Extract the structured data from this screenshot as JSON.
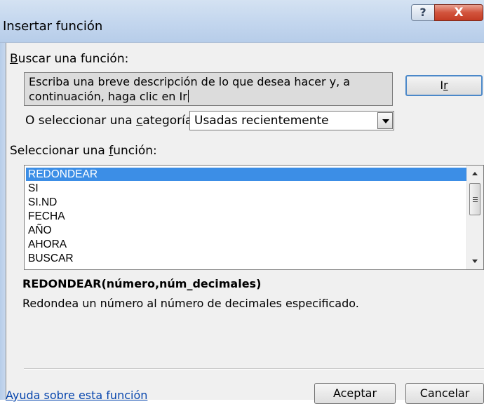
{
  "window": {
    "title": "Insertar función",
    "help_glyph": "?",
    "close_glyph": "X"
  },
  "search": {
    "label_first": "B",
    "label_rest": "uscar una función:",
    "value": "Escriba una breve descripción de lo que desea hacer y, a\ncontinuación, haga clic en Ir",
    "go_button_pre": "I",
    "go_button_under": "r"
  },
  "category": {
    "label_pre": "O seleccionar una ",
    "label_under": "c",
    "label_post": "ategoría:",
    "selected": "Usadas recientemente"
  },
  "functions": {
    "label_pre": "Seleccionar una ",
    "label_under": "f",
    "label_post": "unción:",
    "items": [
      "REDONDEAR",
      "SI",
      "SI.ND",
      "FECHA",
      "AÑO",
      "AHORA",
      "BUSCAR"
    ],
    "selected_index": 0
  },
  "details": {
    "syntax": "REDONDEAR(número,núm_decimales)",
    "description": "Redondea un número al número de decimales especificado."
  },
  "footer": {
    "help_link": "Ayuda sobre esta función",
    "ok_label": "Aceptar",
    "cancel_label": "Cancelar"
  },
  "colors": {
    "selection": "#3c8ee6",
    "title_bar": "#c3d6ee",
    "close_button": "#c43c24",
    "link": "#0645ad"
  }
}
